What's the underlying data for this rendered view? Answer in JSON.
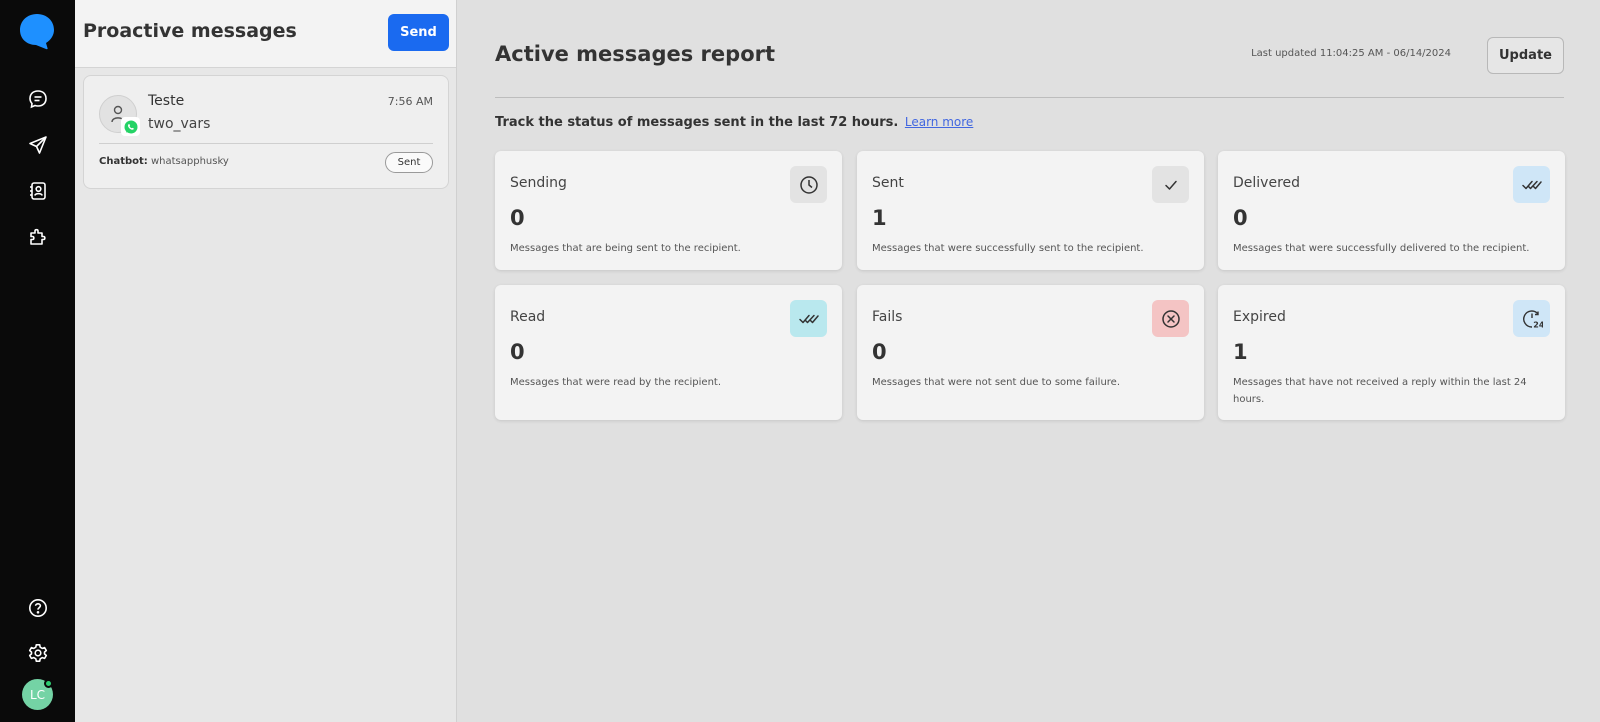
{
  "nav": {
    "logo_icon": "chat-bubble-logo",
    "items": [
      "chat-icon",
      "send-icon",
      "contacts-icon",
      "plugin-icon"
    ],
    "bottom": [
      "help-icon",
      "settings-icon"
    ],
    "avatar_initials": "LC"
  },
  "panel": {
    "title": "Proactive messages",
    "send_label": "Send"
  },
  "message": {
    "name": "Teste",
    "time": "7:56 AM",
    "template": "two_vars",
    "chatbot_label": "Chatbot:",
    "chatbot_value": "whatsapphusky",
    "status": "Sent",
    "channel_icon": "whatsapp-icon"
  },
  "report": {
    "title": "Active messages report",
    "last_updated": "Last updated 11:04:25 AM - 06/14/2024",
    "update_label": "Update",
    "track_text": "Track the status of messages sent in the last 72 hours.",
    "learn_more": "Learn more",
    "cards": [
      {
        "label": "Sending",
        "value": "0",
        "desc": "Messages that are being sent to the recipient.",
        "icon": "clock-icon",
        "icon_bg": "#e3e3e3"
      },
      {
        "label": "Sent",
        "value": "1",
        "desc": "Messages that were successfully sent to the recipient.",
        "icon": "check-icon",
        "icon_bg": "#e3e3e3"
      },
      {
        "label": "Delivered",
        "value": "0",
        "desc": "Messages that were successfully delivered to the recipient.",
        "icon": "double-check-icon",
        "icon_bg": "#cfe6f7"
      },
      {
        "label": "Read",
        "value": "0",
        "desc": "Messages that were read by the recipient.",
        "icon": "double-check-icon",
        "icon_bg": "#b9e8ee"
      },
      {
        "label": "Fails",
        "value": "0",
        "desc": "Messages that were not sent due to some failure.",
        "icon": "x-circle-icon",
        "icon_bg": "#f4c4c4"
      },
      {
        "label": "Expired",
        "value": "1",
        "desc": "Messages that have not received a reply within the last 24 hours.",
        "icon": "clock-24-icon",
        "icon_bg": "#cfe6f7"
      }
    ]
  },
  "colors": {
    "accent": "#1a6af0",
    "rail": "#0a0a0a",
    "logo": "#1e90ff",
    "avatar": "#74d3a5",
    "whatsapp": "#25d366"
  }
}
